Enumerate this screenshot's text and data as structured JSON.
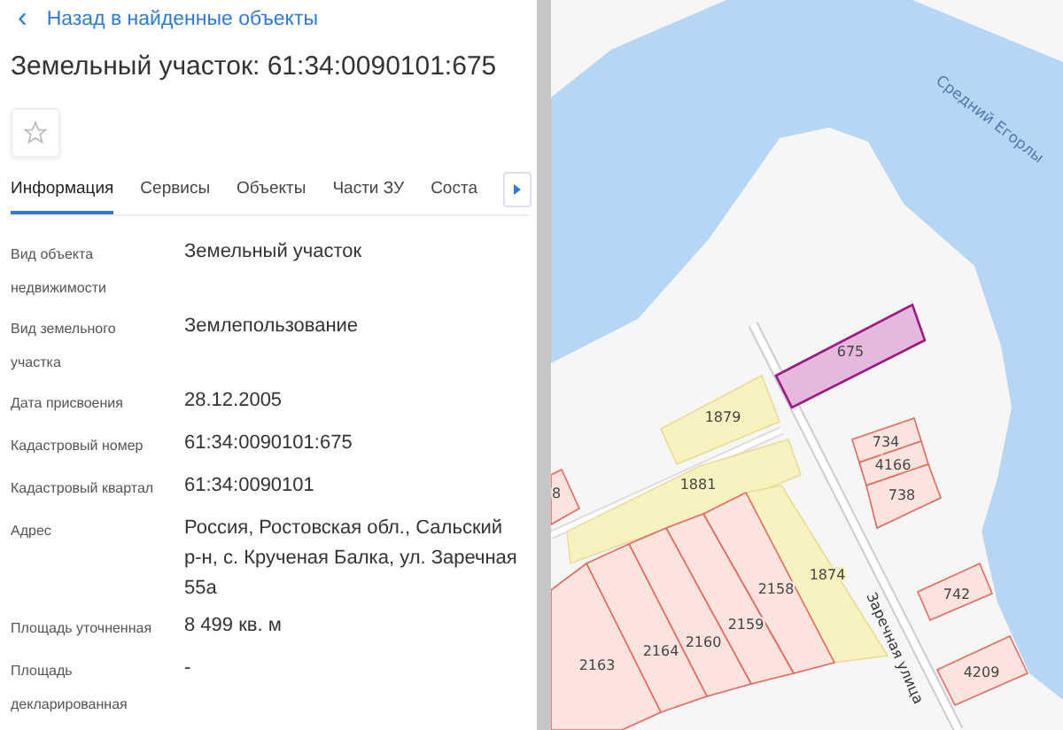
{
  "back_link": {
    "icon": "‹",
    "label": "Назад в найденные объекты"
  },
  "title": "Земельный участок: 61:34:0090101:675",
  "favorite": {
    "on": false
  },
  "tabs": [
    {
      "label": "Информация",
      "selected": true
    },
    {
      "label": "Сервисы",
      "selected": false
    },
    {
      "label": "Объекты",
      "selected": false
    },
    {
      "label": "Части ЗУ",
      "selected": false
    },
    {
      "label": "Соста",
      "selected": false
    }
  ],
  "fields": [
    {
      "label": "Вид объекта недвижимости",
      "value": "Земельный участок"
    },
    {
      "label": "Вид земельного участка",
      "value": "Землепользование"
    },
    {
      "label": "Дата присвоения",
      "value": "28.12.2005"
    },
    {
      "label": "Кадастровый номер",
      "value": "61:34:0090101:675"
    },
    {
      "label": "Кадастровый квартал",
      "value": "61:34:0090101"
    },
    {
      "label": "Адрес",
      "value": "Россия, Ростовская обл., Сальский р-н, с. Крученая Балка, ул. Заречная 55а"
    },
    {
      "label": "Площадь уточненная",
      "value": "8 499 кв. м"
    },
    {
      "label": "Площадь декларированная",
      "value": "-"
    }
  ],
  "map": {
    "river_label": "Средний Егорлы",
    "street_label": "Заречная улица",
    "parcels": [
      {
        "label": "675",
        "kind": "selected"
      },
      {
        "label": "1879",
        "kind": "other"
      },
      {
        "label": "1881",
        "kind": "other"
      },
      {
        "label": "1874",
        "kind": "other"
      },
      {
        "label": "2158",
        "kind": "plot"
      },
      {
        "label": "2159",
        "kind": "plot"
      },
      {
        "label": "2160",
        "kind": "plot"
      },
      {
        "label": "2164",
        "kind": "plot"
      },
      {
        "label": "2163",
        "kind": "plot"
      },
      {
        "label": "734",
        "kind": "plot"
      },
      {
        "label": "4166",
        "kind": "plot"
      },
      {
        "label": "738",
        "kind": "plot"
      },
      {
        "label": "742",
        "kind": "plot"
      },
      {
        "label": "4209",
        "kind": "plot"
      },
      {
        "label": "8",
        "kind": "plot"
      }
    ]
  }
}
